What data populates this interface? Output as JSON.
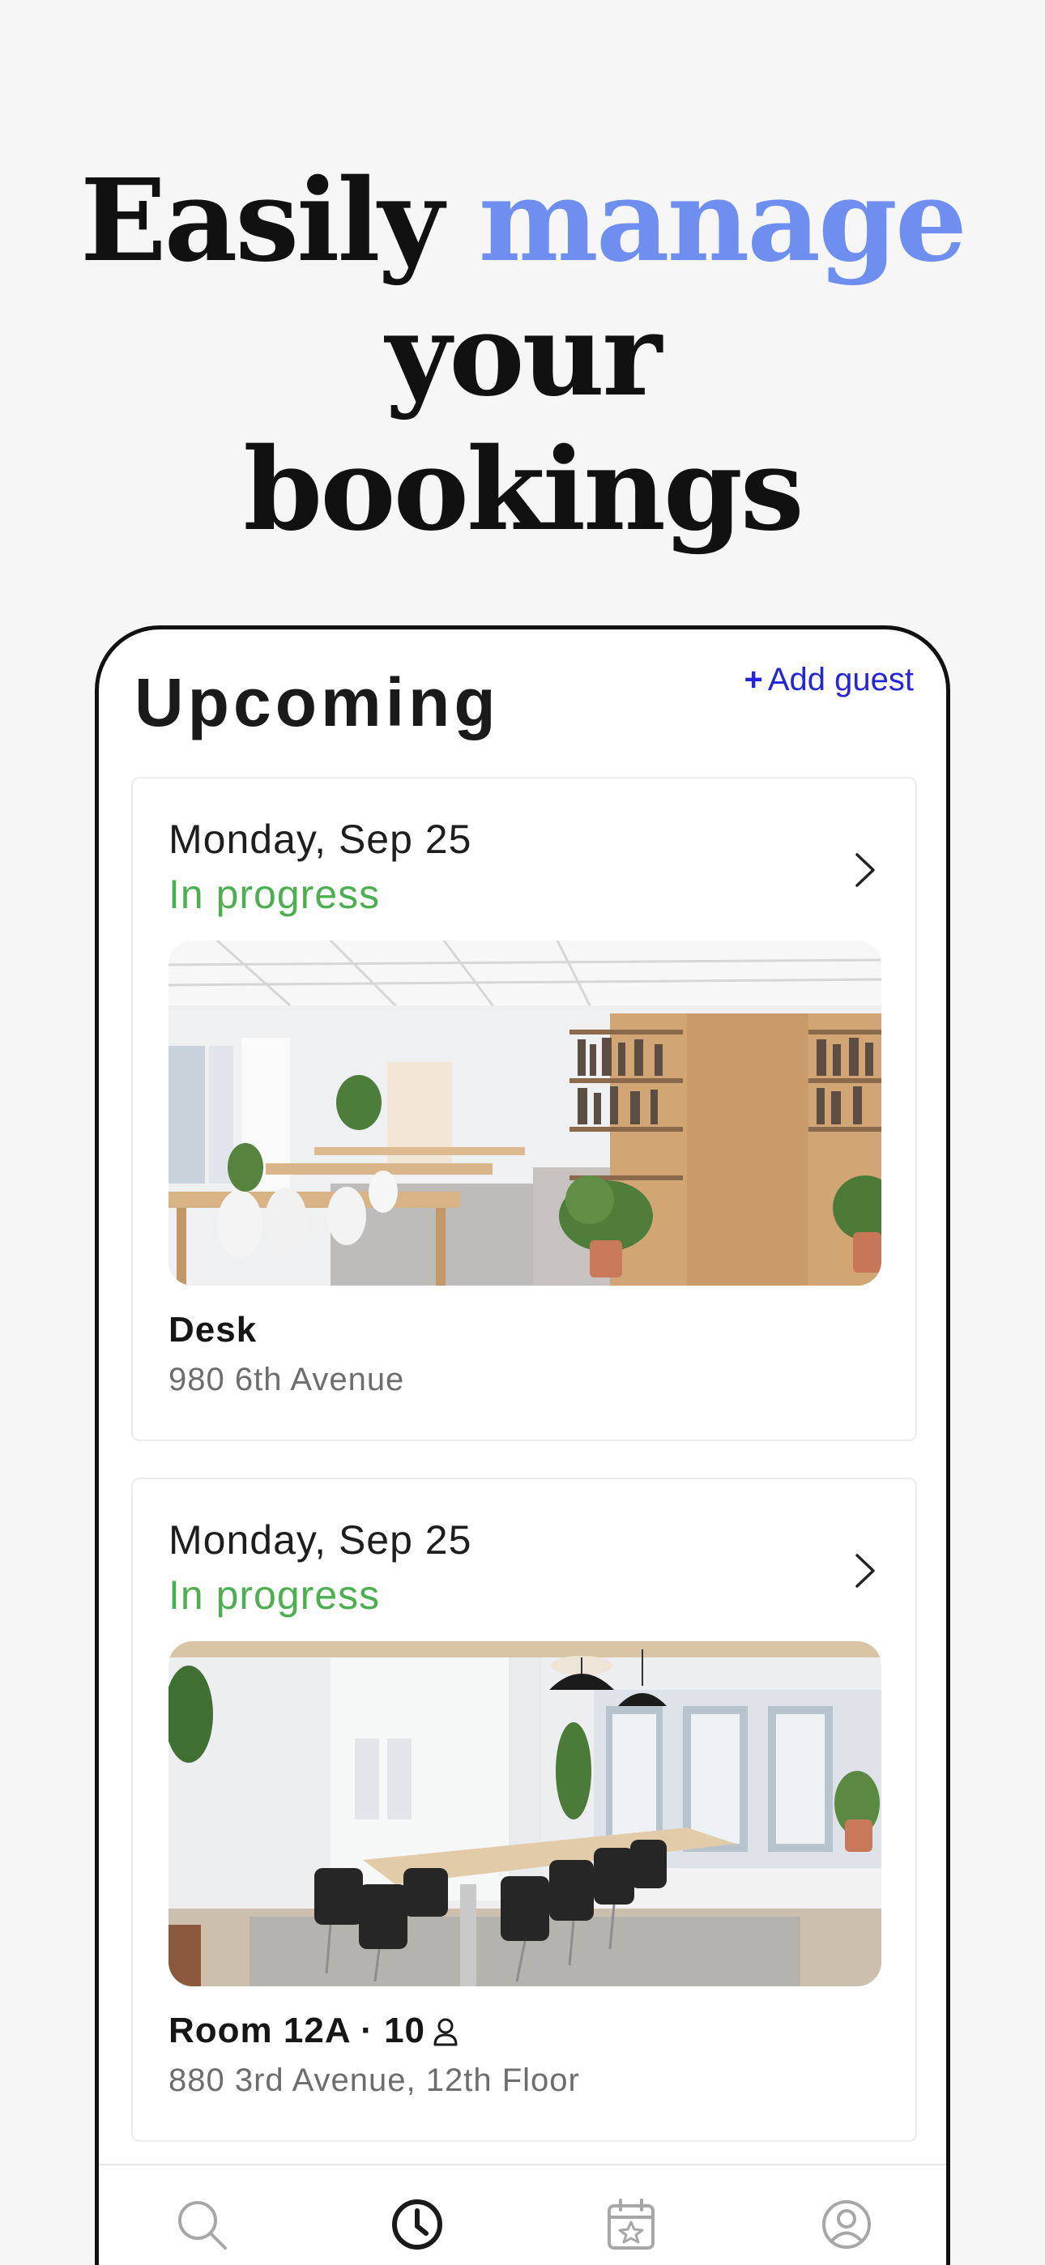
{
  "headline": {
    "part1": "Easily ",
    "accent": "manage",
    "part2": " your",
    "line2": "bookings"
  },
  "screen": {
    "title": "Upcoming",
    "add_guest": {
      "icon": "plus-icon",
      "plus": "+",
      "label": "Add guest"
    },
    "bookings": [
      {
        "date": "Monday, Sep 25",
        "status": "In progress",
        "photo": "open-office-desk-photo",
        "name": "Desk",
        "address": "980 6th Avenue"
      },
      {
        "date": "Monday, Sep 25",
        "status": "In progress",
        "photo": "conference-room-photo",
        "name": "Room 12A · 10",
        "capacity_icon": "person-icon",
        "address": "880 3rd Avenue, 12th Floor"
      }
    ],
    "tabbar": [
      "search-icon",
      "clock-icon",
      "calendar-star-icon",
      "profile-icon"
    ]
  },
  "colors": {
    "accent_headline": "#6f8ff0",
    "link": "#2626d9",
    "status_green": "#4caf50",
    "background": "#f6f6f7"
  }
}
